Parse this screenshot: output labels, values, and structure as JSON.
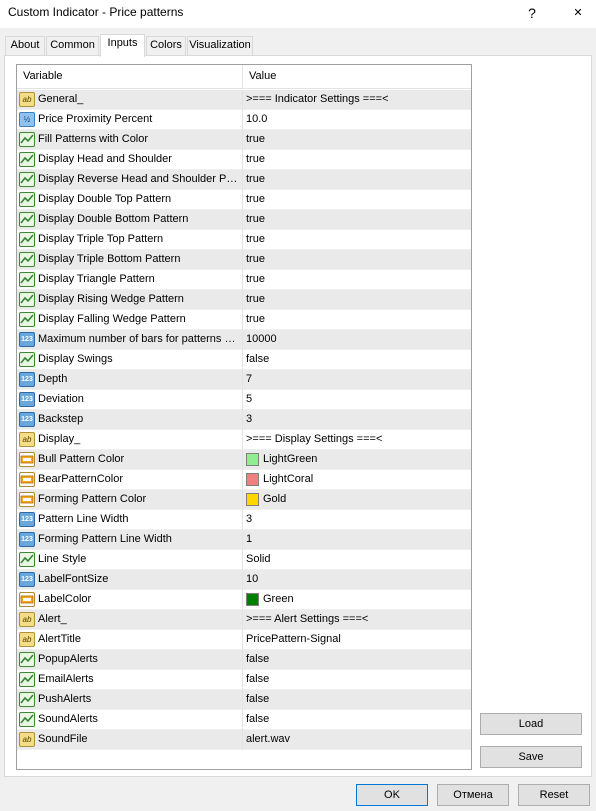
{
  "window": {
    "title": "Custom Indicator - Price patterns",
    "help_label": "?",
    "close_label": "✕"
  },
  "tabs": [
    {
      "label": "About"
    },
    {
      "label": "Common"
    },
    {
      "label": "Inputs"
    },
    {
      "label": "Colors"
    },
    {
      "label": "Visualization"
    }
  ],
  "grid": {
    "col_variable": "Variable",
    "col_value": "Value",
    "rows": [
      {
        "icon": "text-icon",
        "glyph": "ab",
        "name": "General_",
        "value": ">=== Indicator Settings ===<"
      },
      {
        "icon": "fraction-icon",
        "glyph": "½",
        "name": "Price Proximity Percent",
        "value": "10.0"
      },
      {
        "icon": "boolean-icon",
        "glyph": "",
        "name": "Fill Patterns with Color",
        "value": "true"
      },
      {
        "icon": "boolean-icon",
        "glyph": "",
        "name": "Display Head and Shoulder",
        "value": "true"
      },
      {
        "icon": "boolean-icon",
        "glyph": "",
        "name": "Display Reverse Head and Shoulder Pattern",
        "value": "true"
      },
      {
        "icon": "boolean-icon",
        "glyph": "",
        "name": "Display Double Top Pattern",
        "value": "true"
      },
      {
        "icon": "boolean-icon",
        "glyph": "",
        "name": "Display Double Bottom Pattern",
        "value": "true"
      },
      {
        "icon": "boolean-icon",
        "glyph": "",
        "name": "Display Triple Top Pattern",
        "value": "true"
      },
      {
        "icon": "boolean-icon",
        "glyph": "",
        "name": "Display Triple Bottom Pattern",
        "value": "true"
      },
      {
        "icon": "boolean-icon",
        "glyph": "",
        "name": "Display Triangle Pattern",
        "value": "true"
      },
      {
        "icon": "boolean-icon",
        "glyph": "",
        "name": "Display Rising Wedge Pattern",
        "value": "true"
      },
      {
        "icon": "boolean-icon",
        "glyph": "",
        "name": "Display Falling Wedge Pattern",
        "value": "true"
      },
      {
        "icon": "integer-icon",
        "glyph": "123",
        "name": "Maximum number of bars for patterns search",
        "value": "10000"
      },
      {
        "icon": "boolean-icon",
        "glyph": "",
        "name": "Display Swings",
        "value": "false"
      },
      {
        "icon": "integer-icon",
        "glyph": "123",
        "name": "Depth",
        "value": "7"
      },
      {
        "icon": "integer-icon",
        "glyph": "123",
        "name": "Deviation",
        "value": "5"
      },
      {
        "icon": "integer-icon",
        "glyph": "123",
        "name": "Backstep",
        "value": "3"
      },
      {
        "icon": "text-icon",
        "glyph": "ab",
        "name": "Display_",
        "value": ">=== Display Settings ===<"
      },
      {
        "icon": "color-icon",
        "glyph": "",
        "name": "Bull Pattern Color",
        "value": "LightGreen",
        "swatch": "#90ee90"
      },
      {
        "icon": "color-icon",
        "glyph": "",
        "name": "BearPatternColor",
        "value": "LightCoral",
        "swatch": "#f08080"
      },
      {
        "icon": "color-icon",
        "glyph": "",
        "name": "Forming Pattern Color",
        "value": "Gold",
        "swatch": "#ffd700"
      },
      {
        "icon": "integer-icon",
        "glyph": "123",
        "name": "Pattern Line Width",
        "value": "3"
      },
      {
        "icon": "integer-icon",
        "glyph": "123",
        "name": "Forming Pattern Line Width",
        "value": "1"
      },
      {
        "icon": "boolean-icon",
        "glyph": "",
        "name": "Line Style",
        "value": "Solid"
      },
      {
        "icon": "integer-icon",
        "glyph": "123",
        "name": "LabelFontSize",
        "value": "10"
      },
      {
        "icon": "color-icon",
        "glyph": "",
        "name": "LabelColor",
        "value": "Green",
        "swatch": "#008000"
      },
      {
        "icon": "text-icon",
        "glyph": "ab",
        "name": "Alert_",
        "value": ">=== Alert Settings ===<"
      },
      {
        "icon": "text-icon",
        "glyph": "ab",
        "name": "AlertTitle",
        "value": "PricePattern-Signal"
      },
      {
        "icon": "boolean-icon",
        "glyph": "",
        "name": "PopupAlerts",
        "value": "false"
      },
      {
        "icon": "boolean-icon",
        "glyph": "",
        "name": "EmailAlerts",
        "value": "false"
      },
      {
        "icon": "boolean-icon",
        "glyph": "",
        "name": "PushAlerts",
        "value": "false"
      },
      {
        "icon": "boolean-icon",
        "glyph": "",
        "name": "SoundAlerts",
        "value": "false"
      },
      {
        "icon": "text-icon",
        "glyph": "ab",
        "name": "SoundFile",
        "value": "alert.wav"
      }
    ]
  },
  "side_buttons": {
    "load_label": "Load",
    "save_label": "Save"
  },
  "footer": {
    "ok_label": "OK",
    "cancel_label": "Отмена",
    "reset_label": "Reset"
  }
}
